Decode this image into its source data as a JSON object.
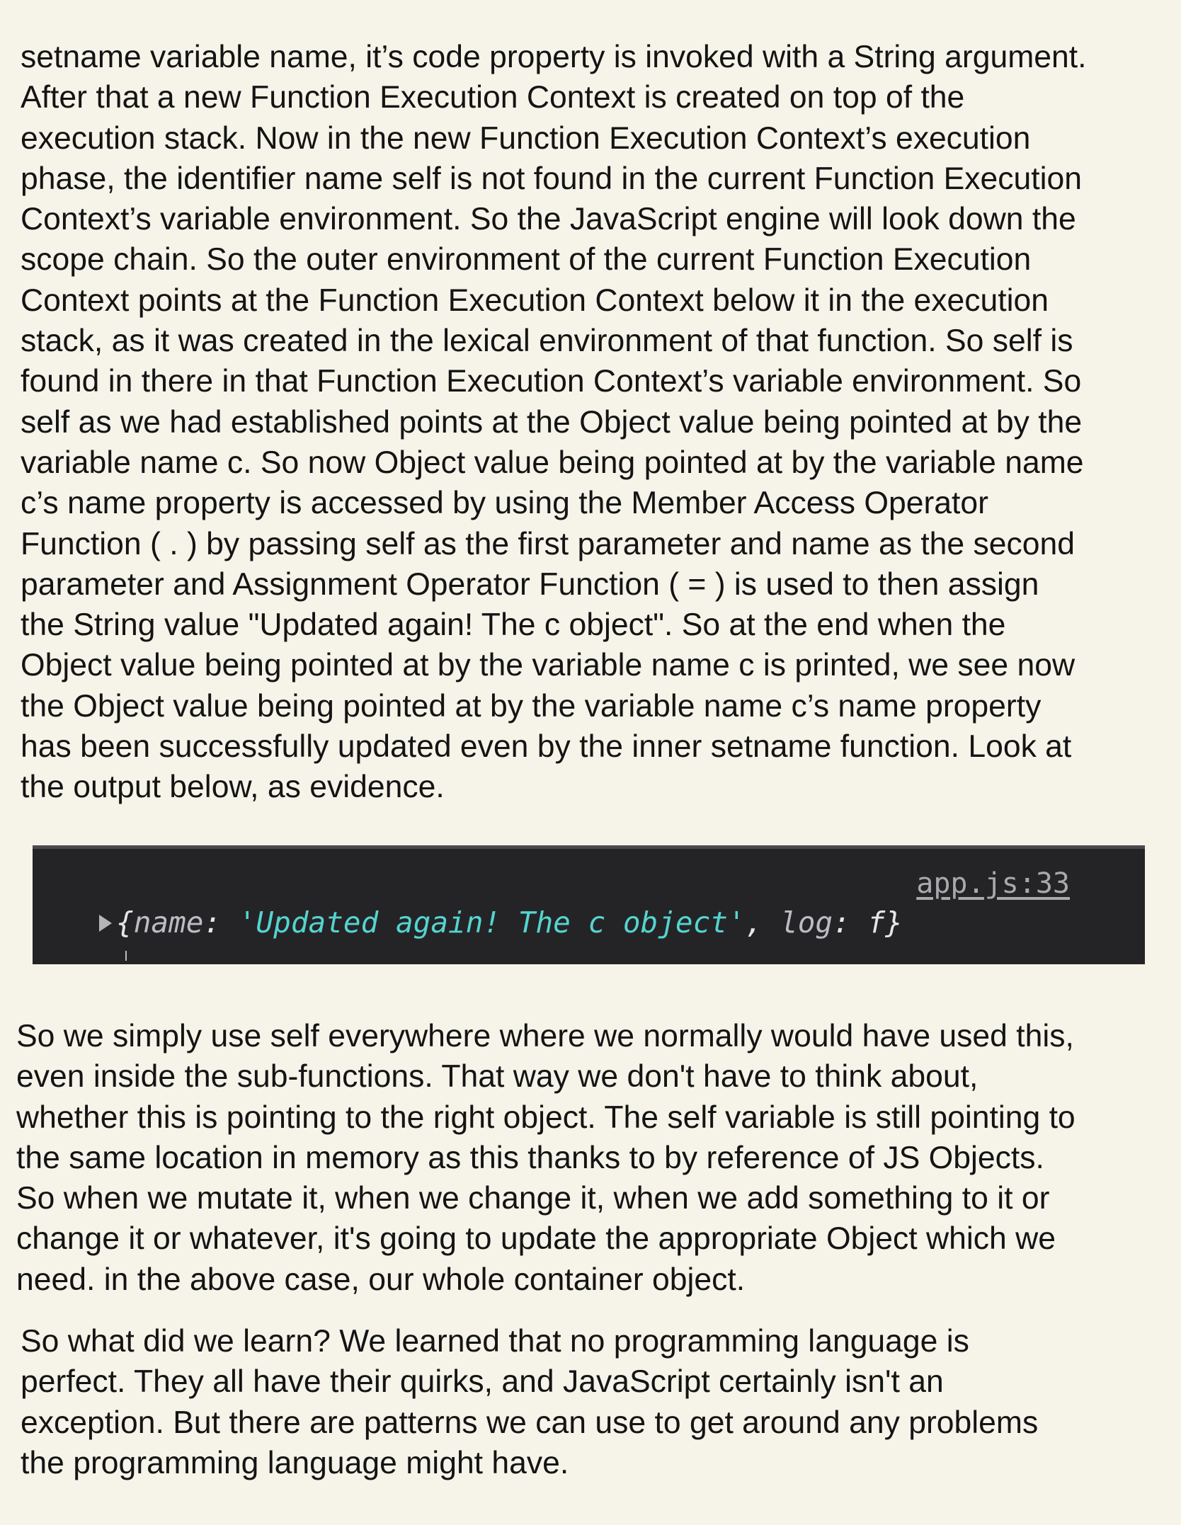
{
  "paragraphs": {
    "p1": "setname variable name, it’s code property is invoked with a String argument.\nAfter that a new Function Execution Context is created on top of the\nexecution stack. Now in the new Function Execution Context’s execution\nphase, the identifier name self is not found in the current Function Execution\nContext’s variable environment. So the JavaScript engine will look down the\nscope chain. So the outer environment of the current Function Execution\nContext points at the Function Execution Context below it in the execution\nstack, as it was created in the lexical environment of that function. So self is\nfound in there in that Function Execution Context’s variable environment. So\nself as we had established points at the Object value being pointed at by the\nvariable name c. So now Object value being pointed at by the variable name\nc’s name property is accessed by using the Member Access Operator\nFunction ( . ) by passing self as the first parameter and name as the second\nparameter and Assignment Operator Function ( = ) is used to then assign\nthe String value \"Updated again! The c object\". So at the end when the\nObject value being pointed at by the variable name c is printed, we see now\nthe Object value being pointed at by the variable name c’s name property\nhas been successfully updated even by the inner setname function. Look at\nthe output below, as evidence.",
    "p2": "So we simply use self everywhere where we normally would have used this,\neven inside the sub-functions. That way we don't have to think about,\nwhether this is pointing to the right object. The self variable is still pointing to\nthe same location in memory as this thanks to by reference of JS Objects.\nSo when we mutate it, when we change it, when we add something to it or\nchange it or whatever, it's going to update the appropriate Object which we\nneed. in the above case, our whole container object.",
    "p3": "So what did we learn? We learned that no programming language is\nperfect. They all have their quirks, and JavaScript certainly isn't an\nexception. But there are patterns we can use to get around any problems\nthe programming language might have."
  },
  "console": {
    "source_link": "app.js:33",
    "open_brace": "{",
    "key_name": "name",
    "colon": ": ",
    "string_value": "'Updated again! The c object'",
    "separator": ", ",
    "key_log": "log",
    "fn_value": "f",
    "close_brace": "}",
    "colors": {
      "background": "#242427",
      "string": "#55d4d0",
      "key": "#bcbcc4",
      "link": "#a9a9ad"
    }
  },
  "colors": {
    "page_background": "#f6f4e9",
    "text": "#141414"
  }
}
